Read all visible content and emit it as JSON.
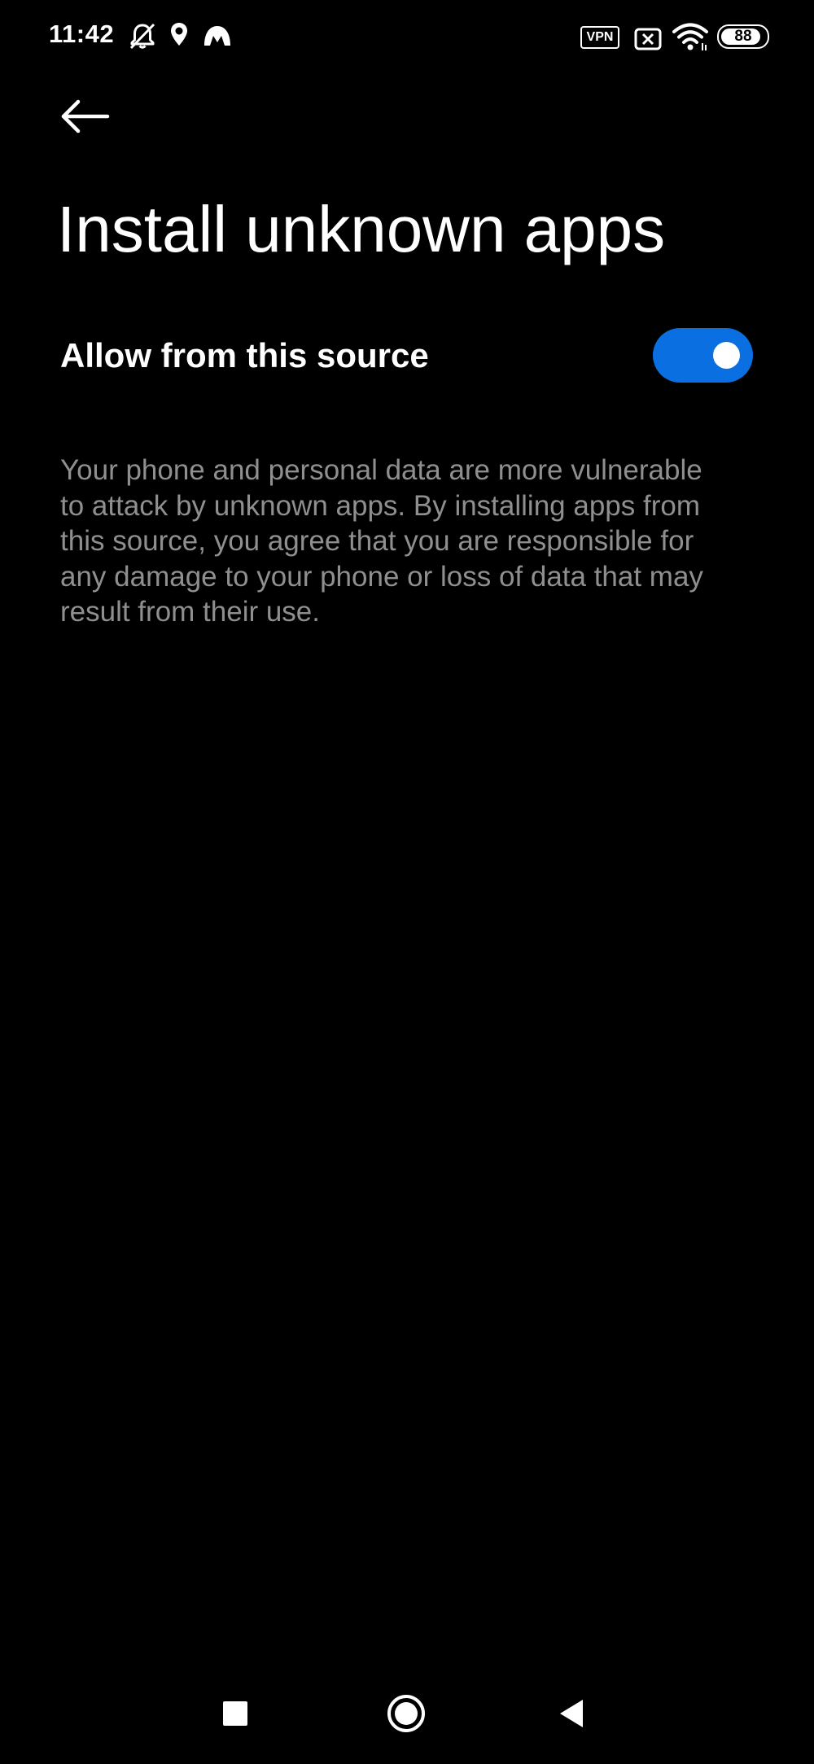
{
  "status_bar": {
    "time": "11:42",
    "vpn_label": "VPN",
    "battery_level": "88",
    "icons": [
      "notifications-off-icon",
      "location-icon",
      "app-notification-icon",
      "vpn-icon",
      "sim-disabled-icon",
      "wifi-icon",
      "battery-icon"
    ]
  },
  "header": {
    "back_icon": "arrow-left-icon",
    "title": "Install unknown apps"
  },
  "setting": {
    "label": "Allow from this source",
    "enabled": true,
    "accent_color": "#0a6fe0"
  },
  "description": "Your phone and personal data are more vulnerable to attack by unknown apps. By installing apps from this source, you agree that you are responsible for any damage to your phone or loss of data that may result from their use.",
  "nav_bar": {
    "icons": [
      "recents-square-icon",
      "home-circle-icon",
      "back-triangle-icon"
    ]
  }
}
